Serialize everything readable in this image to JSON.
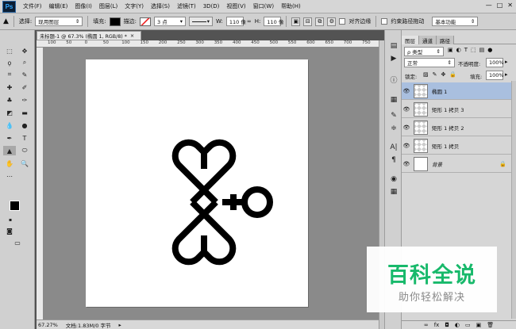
{
  "app": {
    "logo": "Ps"
  },
  "menu": [
    "文件(F)",
    "编辑(E)",
    "图像(I)",
    "图层(L)",
    "文字(Y)",
    "选择(S)",
    "滤镜(T)",
    "3D(D)",
    "视图(V)",
    "窗口(W)",
    "帮助(H)"
  ],
  "window_controls": [
    "—",
    "□",
    "✕"
  ],
  "options": {
    "select_label": "选择:",
    "select_value": "现用图层",
    "fill_label": "填充:",
    "stroke_label": "描边:",
    "stroke_size": "3 点",
    "w_label": "W:",
    "w_value": "110 像",
    "h_label": "H:",
    "h_value": "110 像",
    "align_edges": "对齐边缘",
    "constrain_path": "约束路径拖动",
    "workspace": "基本功能"
  },
  "document": {
    "tab_title": "未标题-1 @ 67.3% (椭圆 1, RGB/8) *",
    "ruler_marks": [
      "100",
      "50",
      "0",
      "50",
      "100",
      "150",
      "200",
      "250",
      "300",
      "350",
      "400",
      "450",
      "500",
      "550",
      "600",
      "650",
      "700",
      "750"
    ]
  },
  "status": {
    "zoom": "67.27%",
    "doc_info": "文档:1.83M/0 字节"
  },
  "layers_panel": {
    "tabs": [
      "图层",
      "通道",
      "路径"
    ],
    "filter_kind": "ρ 类型",
    "blend_mode": "正常",
    "opacity_label": "不透明度:",
    "opacity_value": "100%",
    "lock_label": "锁定:",
    "fill_label": "填充:",
    "fill_value": "100%",
    "layers": [
      {
        "name": "椭圆 1",
        "selected": true
      },
      {
        "name": "矩形 1 拷贝 3",
        "selected": false
      },
      {
        "name": "矩形 1 拷贝 2",
        "selected": false
      },
      {
        "name": "矩形 1 拷贝",
        "selected": false
      },
      {
        "name": "背景",
        "selected": false,
        "locked": true
      }
    ],
    "bottom_icons": [
      "link-icon",
      "fx-icon",
      "mask-icon",
      "adjustment-icon",
      "group-icon",
      "new-layer-icon",
      "trash-icon"
    ]
  },
  "watermark": {
    "title": "百科全说",
    "subtitle": "助你轻松解决"
  },
  "colors": {
    "accent": "#31a8ff",
    "watermark_green": "#18b96b",
    "selected_layer": "#a9bfdf"
  }
}
